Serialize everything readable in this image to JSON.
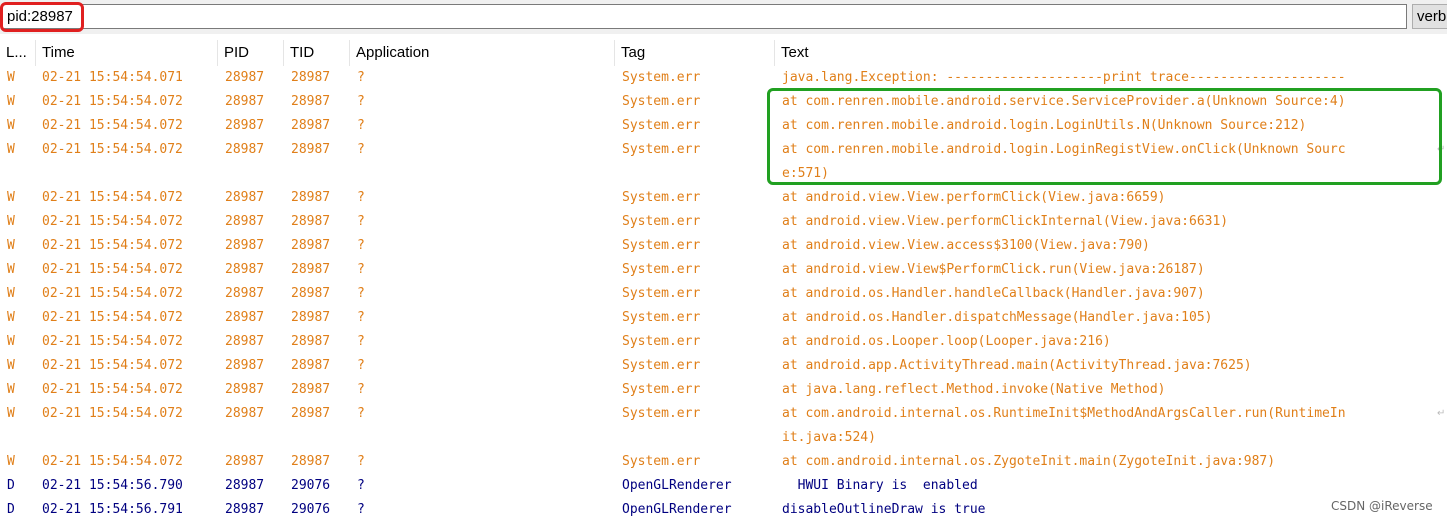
{
  "filter": {
    "value": "pid:28987"
  },
  "level_select": {
    "value": "verb"
  },
  "columns": [
    "L...",
    "Time",
    "PID",
    "TID",
    "Application",
    "Tag",
    "Text"
  ],
  "colors": {
    "warn": "#e07f19",
    "debug": "#000080",
    "highlight_red": "#e02020",
    "highlight_green": "#21a021"
  },
  "rows": [
    {
      "level": "W",
      "time": "02-21 15:54:54.071",
      "pid": "28987",
      "tid": "28987",
      "app": "?",
      "tag": "System.err",
      "text": [
        "java.lang.Exception: --------------------print trace--------------------"
      ]
    },
    {
      "level": "W",
      "time": "02-21 15:54:54.072",
      "pid": "28987",
      "tid": "28987",
      "app": "?",
      "tag": "System.err",
      "text": [
        "at com.renren.mobile.android.service.ServiceProvider.a(Unknown Source:4)"
      ]
    },
    {
      "level": "W",
      "time": "02-21 15:54:54.072",
      "pid": "28987",
      "tid": "28987",
      "app": "?",
      "tag": "System.err",
      "text": [
        "at com.renren.mobile.android.login.LoginUtils.N(Unknown Source:212)"
      ]
    },
    {
      "level": "W",
      "time": "02-21 15:54:54.072",
      "pid": "28987",
      "tid": "28987",
      "app": "?",
      "tag": "System.err",
      "text": [
        "at com.renren.mobile.android.login.LoginRegistView.onClick(Unknown Sourc",
        "e:571)"
      ]
    },
    {
      "level": "W",
      "time": "02-21 15:54:54.072",
      "pid": "28987",
      "tid": "28987",
      "app": "?",
      "tag": "System.err",
      "text": [
        "at android.view.View.performClick(View.java:6659)"
      ]
    },
    {
      "level": "W",
      "time": "02-21 15:54:54.072",
      "pid": "28987",
      "tid": "28987",
      "app": "?",
      "tag": "System.err",
      "text": [
        "at android.view.View.performClickInternal(View.java:6631)"
      ]
    },
    {
      "level": "W",
      "time": "02-21 15:54:54.072",
      "pid": "28987",
      "tid": "28987",
      "app": "?",
      "tag": "System.err",
      "text": [
        "at android.view.View.access$3100(View.java:790)"
      ]
    },
    {
      "level": "W",
      "time": "02-21 15:54:54.072",
      "pid": "28987",
      "tid": "28987",
      "app": "?",
      "tag": "System.err",
      "text": [
        "at android.view.View$PerformClick.run(View.java:26187)"
      ]
    },
    {
      "level": "W",
      "time": "02-21 15:54:54.072",
      "pid": "28987",
      "tid": "28987",
      "app": "?",
      "tag": "System.err",
      "text": [
        "at android.os.Handler.handleCallback(Handler.java:907)"
      ]
    },
    {
      "level": "W",
      "time": "02-21 15:54:54.072",
      "pid": "28987",
      "tid": "28987",
      "app": "?",
      "tag": "System.err",
      "text": [
        "at android.os.Handler.dispatchMessage(Handler.java:105)"
      ]
    },
    {
      "level": "W",
      "time": "02-21 15:54:54.072",
      "pid": "28987",
      "tid": "28987",
      "app": "?",
      "tag": "System.err",
      "text": [
        "at android.os.Looper.loop(Looper.java:216)"
      ]
    },
    {
      "level": "W",
      "time": "02-21 15:54:54.072",
      "pid": "28987",
      "tid": "28987",
      "app": "?",
      "tag": "System.err",
      "text": [
        "at android.app.ActivityThread.main(ActivityThread.java:7625)"
      ]
    },
    {
      "level": "W",
      "time": "02-21 15:54:54.072",
      "pid": "28987",
      "tid": "28987",
      "app": "?",
      "tag": "System.err",
      "text": [
        "at java.lang.reflect.Method.invoke(Native Method)"
      ]
    },
    {
      "level": "W",
      "time": "02-21 15:54:54.072",
      "pid": "28987",
      "tid": "28987",
      "app": "?",
      "tag": "System.err",
      "text": [
        "at com.android.internal.os.RuntimeInit$MethodAndArgsCaller.run(RuntimeIn",
        "it.java:524)"
      ]
    },
    {
      "level": "W",
      "time": "02-21 15:54:54.072",
      "pid": "28987",
      "tid": "28987",
      "app": "?",
      "tag": "System.err",
      "text": [
        "at com.android.internal.os.ZygoteInit.main(ZygoteInit.java:987)"
      ]
    },
    {
      "level": "D",
      "time": "02-21 15:54:56.790",
      "pid": "28987",
      "tid": "29076",
      "app": "?",
      "tag": "OpenGLRenderer",
      "text": [
        "  HWUI Binary is  enabled"
      ]
    },
    {
      "level": "D",
      "time": "02-21 15:54:56.791",
      "pid": "28987",
      "tid": "29076",
      "app": "?",
      "tag": "OpenGLRenderer",
      "text": [
        "disableOutlineDraw is true"
      ]
    }
  ],
  "watermark": "CSDN @iReverse"
}
